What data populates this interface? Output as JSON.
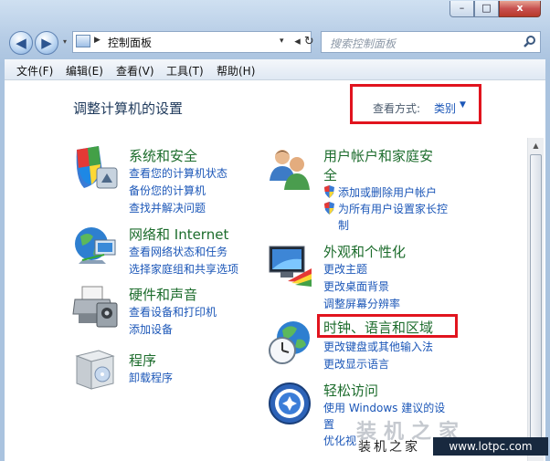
{
  "window": {
    "caption": {
      "minimize": "–",
      "maximize": "□",
      "close": "x"
    }
  },
  "nav": {
    "back": "◀",
    "forward": "▶",
    "recent": "▾",
    "address_sep": "▶",
    "address": "控制面板",
    "address_drop": "▾",
    "refresh": "◂ ↻",
    "search_placeholder": "搜索控制面板"
  },
  "menu": [
    "文件(F)",
    "编辑(E)",
    "查看(V)",
    "工具(T)",
    "帮助(H)"
  ],
  "page": {
    "title": "调整计算机的设置",
    "view_by_label": "查看方式:",
    "view_by_value": "类别",
    "view_by_arrow": "▼"
  },
  "categories": {
    "system": {
      "title": "系统和安全",
      "links": [
        "查看您的计算机状态",
        "备份您的计算机",
        "查找并解决问题"
      ],
      "icon": "shield-icon"
    },
    "network": {
      "title": "网络和 Internet",
      "links": [
        "查看网络状态和任务",
        "选择家庭组和共享选项"
      ],
      "icon": "network-globe-icon"
    },
    "hardware": {
      "title": "硬件和声音",
      "links": [
        "查看设备和打印机",
        "添加设备"
      ],
      "icon": "printer-icon"
    },
    "programs": {
      "title": "程序",
      "links": [
        "卸载程序"
      ],
      "icon": "programs-box-icon"
    },
    "users": {
      "title_line1": "用户帐户和家庭安",
      "title_line2": "全",
      "links": [
        "添加或删除用户帐户",
        "为所有用户设置家长控",
        "制"
      ],
      "icon": "users-icon"
    },
    "appearance": {
      "title": "外观和个性化",
      "links": [
        "更改主题",
        "更改桌面背景",
        "调整屏幕分辨率"
      ],
      "icon": "monitor-palette-icon"
    },
    "clock": {
      "title": "时钟、语言和区域",
      "links": [
        "更改键盘或其他输入法",
        "更改显示语言"
      ],
      "icon": "globe-clock-icon"
    },
    "ease": {
      "title": "轻松访问",
      "links": [
        "使用 Windows 建议的设",
        "置",
        "优化视"
      ],
      "icon": "ease-of-access-icon"
    }
  },
  "watermark": {
    "big": "装机之家",
    "small": "装机之家",
    "url": "www.lotpc.com"
  },
  "colors": {
    "highlight": "#e1141e",
    "link": "#1c57b8",
    "category": "#1c6c2c"
  }
}
